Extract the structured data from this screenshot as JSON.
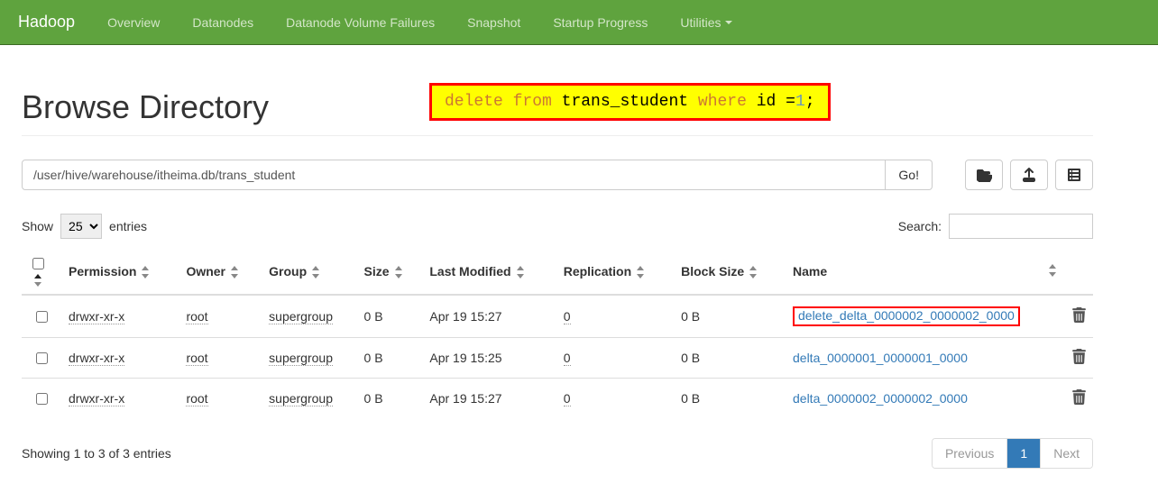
{
  "navbar": {
    "brand": "Hadoop",
    "items": [
      "Overview",
      "Datanodes",
      "Datanode Volume Failures",
      "Snapshot",
      "Startup Progress",
      "Utilities"
    ]
  },
  "page": {
    "title": "Browse Directory",
    "annotation_parts": {
      "delete": "delete",
      "from": "from",
      "table": "trans_student",
      "where": "where",
      "col": "id",
      "eq": " =",
      "val": "1",
      "semi": ";"
    }
  },
  "pathbar": {
    "value": "/user/hive/warehouse/itheima.db/trans_student",
    "go_label": "Go!"
  },
  "table_controls": {
    "show_label": "Show",
    "entries_label": "entries",
    "page_size": "25",
    "search_label": "Search:"
  },
  "columns": {
    "permission": "Permission",
    "owner": "Owner",
    "group": "Group",
    "size": "Size",
    "last_modified": "Last Modified",
    "replication": "Replication",
    "block_size": "Block Size",
    "name": "Name"
  },
  "rows": [
    {
      "permission": "drwxr-xr-x",
      "owner": "root",
      "group": "supergroup",
      "size": "0 B",
      "last_modified": "Apr 19 15:27",
      "replication": "0",
      "block_size": "0 B",
      "name": "delete_delta_0000002_0000002_0000",
      "highlighted": true
    },
    {
      "permission": "drwxr-xr-x",
      "owner": "root",
      "group": "supergroup",
      "size": "0 B",
      "last_modified": "Apr 19 15:25",
      "replication": "0",
      "block_size": "0 B",
      "name": "delta_0000001_0000001_0000",
      "highlighted": false
    },
    {
      "permission": "drwxr-xr-x",
      "owner": "root",
      "group": "supergroup",
      "size": "0 B",
      "last_modified": "Apr 19 15:27",
      "replication": "0",
      "block_size": "0 B",
      "name": "delta_0000002_0000002_0000",
      "highlighted": false
    }
  ],
  "footer": {
    "info": "Showing 1 to 3 of 3 entries",
    "previous": "Previous",
    "next": "Next",
    "current_page": "1"
  }
}
